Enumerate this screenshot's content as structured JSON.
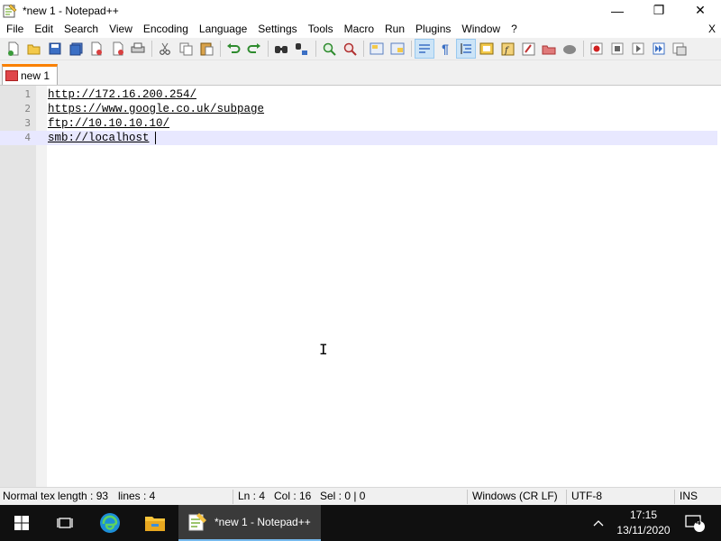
{
  "window": {
    "title": "*new 1 - Notepad++",
    "minimize": "—",
    "restore": "❐",
    "close": "✕"
  },
  "menu": {
    "items": [
      "File",
      "Edit",
      "Search",
      "View",
      "Encoding",
      "Language",
      "Settings",
      "Tools",
      "Macro",
      "Run",
      "Plugins",
      "Window",
      "?"
    ],
    "close_label": "X"
  },
  "toolbar": {
    "icons": [
      "new-file-icon",
      "open-file-icon",
      "save-icon",
      "save-all-icon",
      "close-icon",
      "close-all-icon",
      "print-icon",
      "cut-icon",
      "copy-icon",
      "paste-icon",
      "undo-icon",
      "redo-icon",
      "find-icon",
      "replace-icon",
      "zoom-in-icon",
      "zoom-out-icon",
      "sync-vertical-icon",
      "sync-horizontal-icon",
      "word-wrap-icon",
      "show-all-chars-icon",
      "indent-guide-icon",
      "doc-map-icon",
      "function-list-icon",
      "folder-workspace-icon",
      "monitoring-icon",
      "record-macro-icon",
      "stop-macro-icon",
      "play-macro-icon",
      "run-macro-multiple-icon",
      "save-macro-icon"
    ]
  },
  "tabs": [
    {
      "label": "new 1"
    }
  ],
  "editor": {
    "lines": [
      {
        "num": "1",
        "text": "http://172.16.200.254/"
      },
      {
        "num": "2",
        "text": "https://www.google.co.uk/subpage"
      },
      {
        "num": "3",
        "text": "ftp://10.10.10.10/"
      },
      {
        "num": "4",
        "text": "smb://localhost"
      }
    ],
    "current_line": 4,
    "cursor_glyph": "I"
  },
  "status": {
    "lang": "Normal text file",
    "length": "length : 93",
    "lines": "lines : 4",
    "ln": "Ln : 4",
    "col": "Col : 16",
    "sel": "Sel : 0 | 0",
    "eol": "Windows (CR LF)",
    "encoding": "UTF-8",
    "mode": "INS"
  },
  "taskbar": {
    "task_label": "*new 1 - Notepad++",
    "time": "17:15",
    "date": "13/11/2020",
    "notifications": "4",
    "tray_chevron": "^"
  }
}
